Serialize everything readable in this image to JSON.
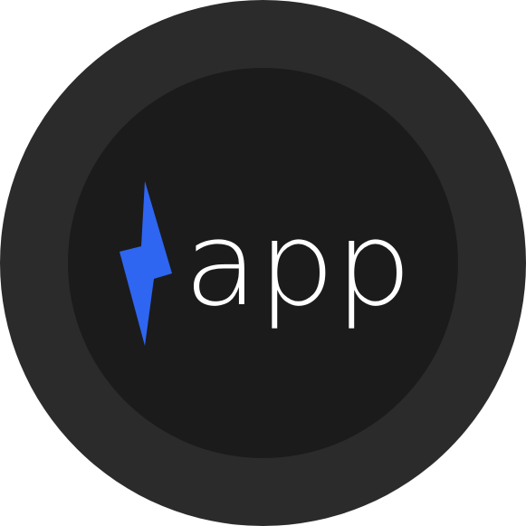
{
  "logo": {
    "wordmark": "app",
    "icon": "lightning-bolt-icon"
  },
  "colors": {
    "outer_ring": "#2b2b2b",
    "inner_disc": "#1b1b1b",
    "bolt": "#2e66f2",
    "wordmark": "#ffffff",
    "background": "#ffffff"
  }
}
